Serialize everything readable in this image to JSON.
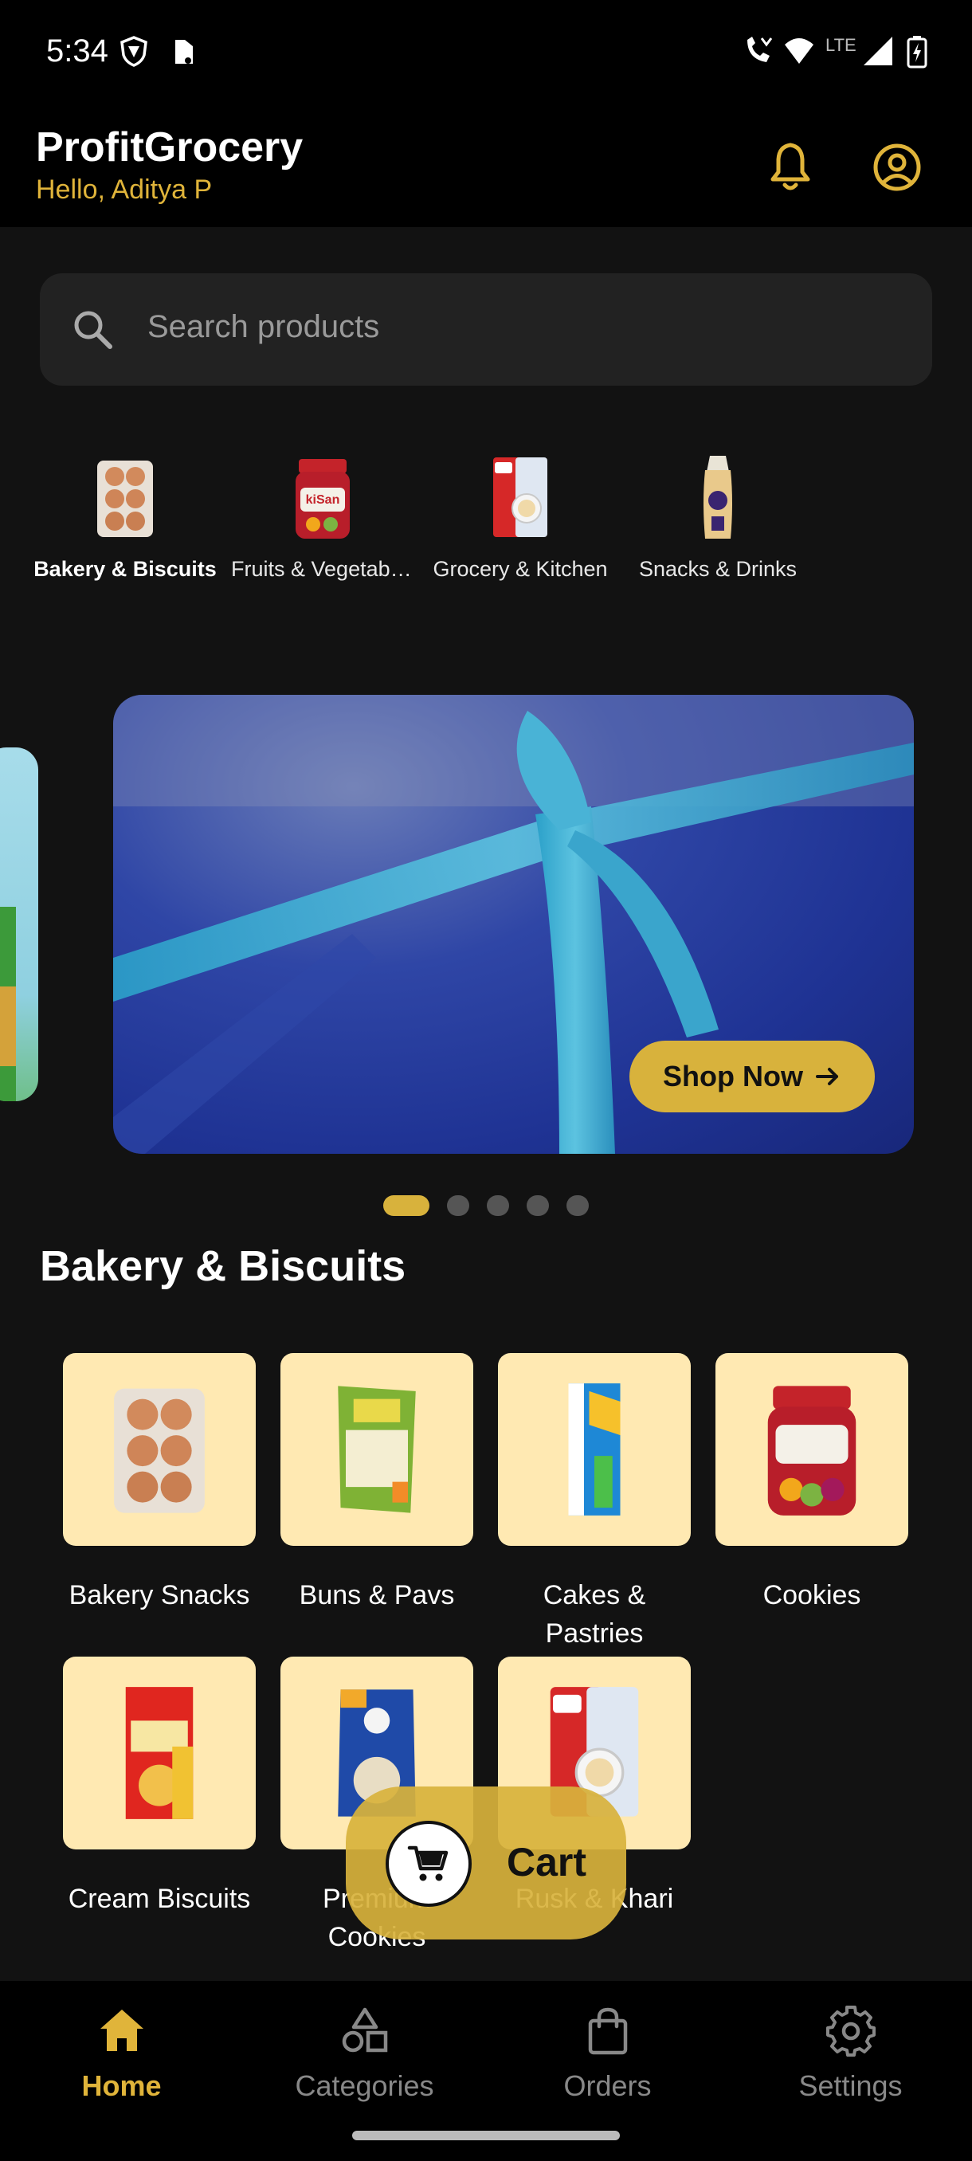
{
  "status_bar": {
    "time": "5:34",
    "network": "LTE"
  },
  "header": {
    "title": "ProfitGrocery",
    "greeting": "Hello, Aditya P"
  },
  "search": {
    "placeholder": "Search products"
  },
  "categories": [
    {
      "label": "Bakery & Biscuits",
      "active": true,
      "icon": "eggs-tray-icon"
    },
    {
      "label": "Fruits & Vegetables",
      "active": false,
      "icon": "jam-jar-icon"
    },
    {
      "label": "Grocery & Kitchen",
      "active": false,
      "icon": "vermicelli-pack-icon"
    },
    {
      "label": "Snacks & Drinks",
      "active": false,
      "icon": "snack-pack-icon"
    }
  ],
  "banner": {
    "button_label": "Shop Now",
    "dots_total": 5,
    "active_dot": 1
  },
  "section": {
    "title": "Bakery & Biscuits"
  },
  "subcategories": [
    {
      "label": "Bakery Snacks",
      "icon": "eggs-tray-icon"
    },
    {
      "label": "Buns & Pavs",
      "icon": "paneer-pack-icon"
    },
    {
      "label": "Cakes & Pastries",
      "icon": "cheese-slices-icon"
    },
    {
      "label": "Cookies",
      "icon": "jam-jar-icon"
    },
    {
      "label": "Cream Biscuits",
      "icon": "corn-flakes-box-icon"
    },
    {
      "label": "Premium Cookies",
      "icon": "oats-pack-icon"
    },
    {
      "label": "Rusk & Khari",
      "icon": "vermicelli-pack-icon"
    }
  ],
  "cart": {
    "label": "Cart"
  },
  "nav": [
    {
      "label": "Home",
      "active": true,
      "icon": "home-icon"
    },
    {
      "label": "Categories",
      "active": false,
      "icon": "categories-icon"
    },
    {
      "label": "Orders",
      "active": false,
      "icon": "shopping-bag-icon"
    },
    {
      "label": "Settings",
      "active": false,
      "icon": "gear-icon"
    }
  ],
  "colors": {
    "accent": "#D8B23C",
    "tile_bg": "#FFE9B2",
    "background": "#121212"
  }
}
